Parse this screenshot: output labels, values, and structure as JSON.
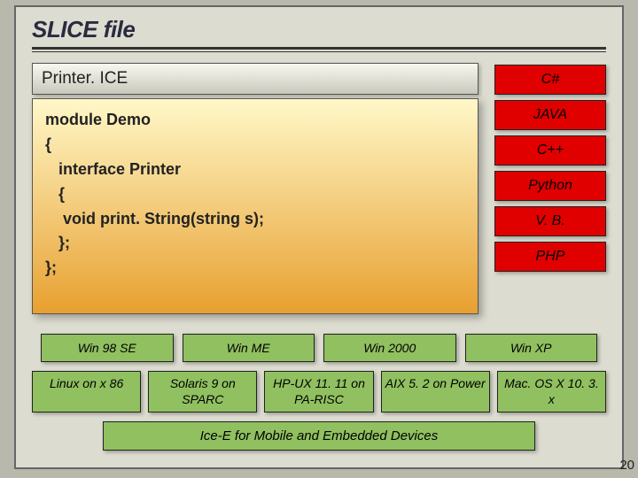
{
  "title": "SLICE file",
  "code_title": "Printer. ICE",
  "code_body": "module Demo\n{\n   interface Printer\n   {\n    void print. String(string s);\n   };\n};",
  "languages": [
    "C#",
    "JAVA",
    "C++",
    "Python",
    "V. B.",
    "PHP"
  ],
  "os_row1": [
    "Win 98 SE",
    "Win ME",
    "Win 2000",
    "Win XP"
  ],
  "os_row2": [
    "Linux on\nx 86",
    "Solaris 9 on\nSPARC",
    "HP-UX 11. 11\non PA-RISC",
    "AIX 5. 2 on\nPower",
    "Mac. OS X\n10. 3. x"
  ],
  "footer": "Ice-E for Mobile and Embedded Devices",
  "page_number": "20"
}
